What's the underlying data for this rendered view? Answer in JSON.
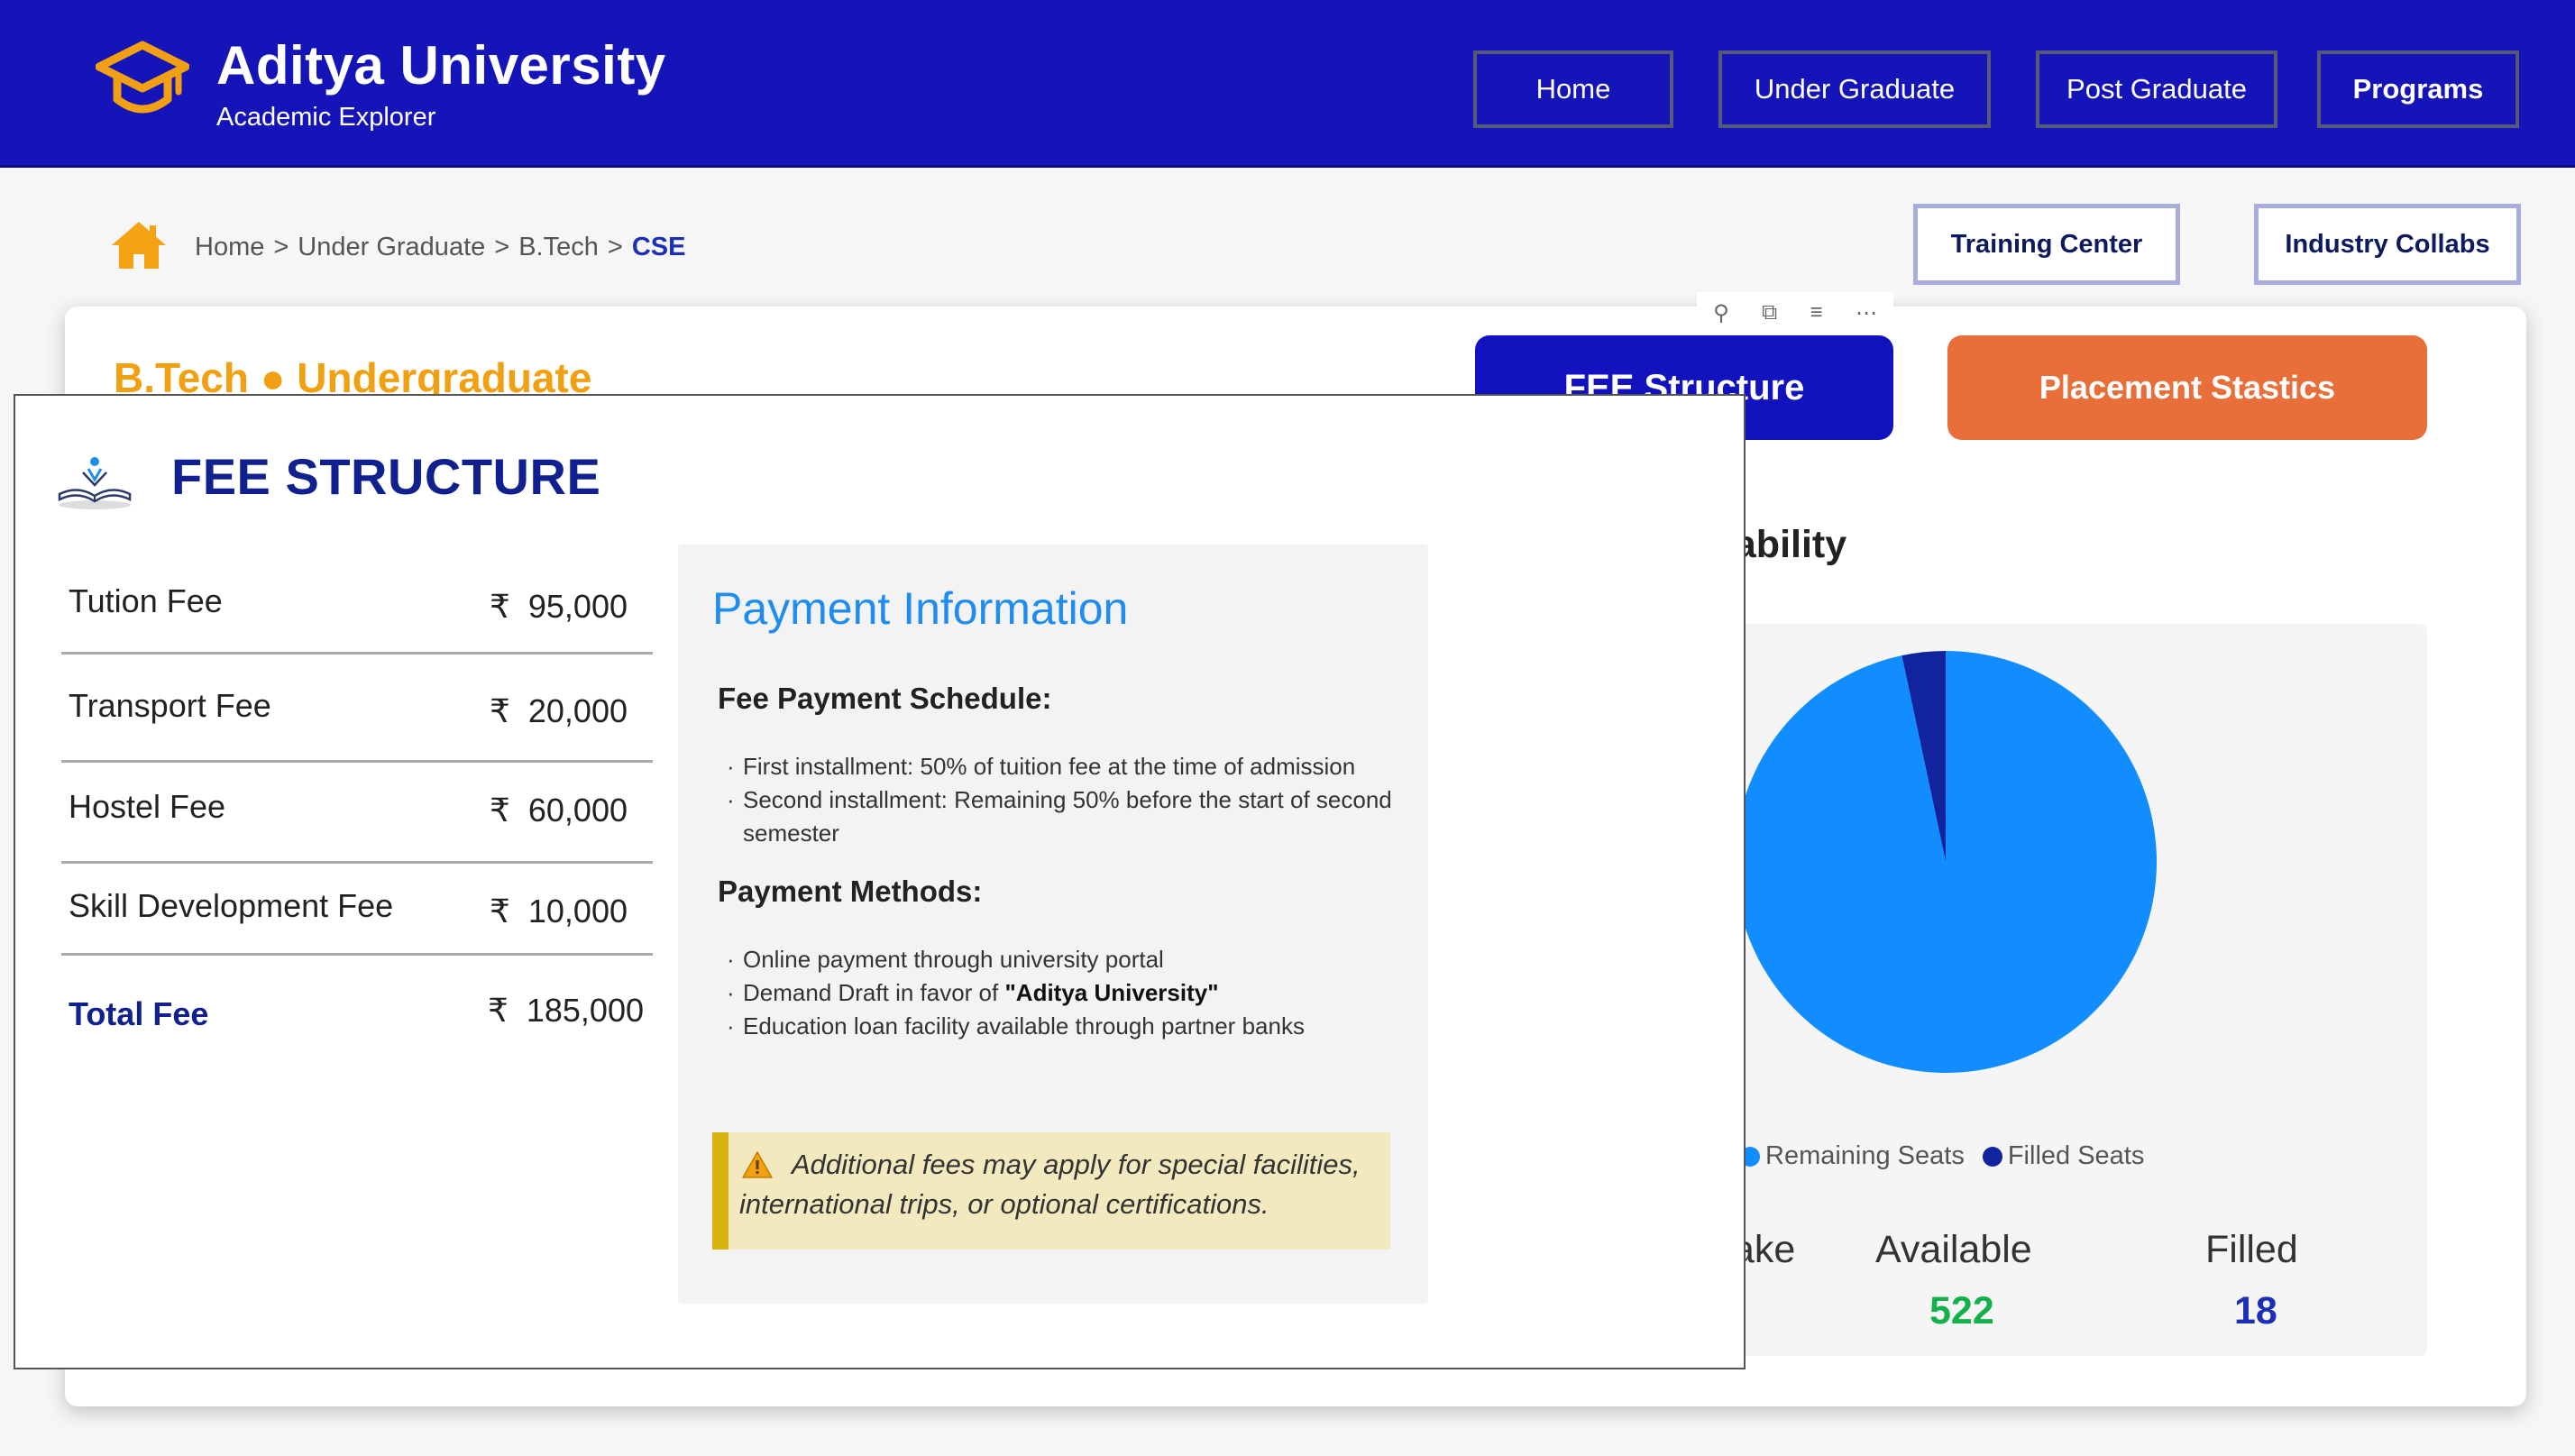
{
  "header": {
    "brand_title": "Aditya University",
    "brand_subtitle": "Academic Explorer",
    "nav": [
      {
        "label": "Home"
      },
      {
        "label": "Under Graduate"
      },
      {
        "label": "Post Graduate"
      },
      {
        "label": "Programs"
      }
    ],
    "colors": {
      "background": "#1414b8",
      "logo": "#f0a011"
    }
  },
  "breadcrumb": {
    "items": [
      "Home",
      "Under Graduate",
      "B.Tech"
    ],
    "separator": ">",
    "current": "CSE"
  },
  "actions": {
    "training_center": "Training Center",
    "industry_collabs": "Industry Collabs"
  },
  "card": {
    "title": "B.Tech ● Undergraduate",
    "fee_button": "FEE Structure",
    "placement_button": "Placement Stastics",
    "chart_heading_fragment": "ilability",
    "visual_toolbar": [
      "pin-icon",
      "copy-icon",
      "filter-icon",
      "more-icon"
    ]
  },
  "chart_data": {
    "type": "pie",
    "series": [
      {
        "name": "Remaining Seats",
        "value": 522,
        "color": "#118dff"
      },
      {
        "name": "Filled Seats",
        "value": 18,
        "color": "#12239e"
      }
    ],
    "legend_position": "bottom-left"
  },
  "stats": {
    "intake_fragment": "ake",
    "available_label": "Available",
    "available_value": "522",
    "filled_label": "Filled",
    "filled_value": "18",
    "colors": {
      "available": "#14b04c",
      "filled": "#1c2fb5"
    }
  },
  "fee_popup": {
    "title": "FEE STRUCTURE",
    "currency": "₹",
    "rows": [
      {
        "name": "Tution Fee",
        "amount": "95,000"
      },
      {
        "name": "Transport Fee",
        "amount": "20,000"
      },
      {
        "name": "Hostel Fee",
        "amount": "60,000"
      },
      {
        "name": "Skill Development Fee",
        "amount": "10,000"
      }
    ],
    "total": {
      "name": "Total Fee",
      "amount": "185,000"
    },
    "payment": {
      "title": "Payment Information",
      "schedule_heading": "Fee Payment Schedule:",
      "schedule": [
        "First installment: 50% of tuition fee at the time of admission",
        "Second installment: Remaining 50% before the start of second semester"
      ],
      "methods_heading": "Payment Methods:",
      "method_online": "Online payment through university portal",
      "method_dd_prefix": "Demand Draft in favor of ",
      "method_dd_name": "\"Aditya University\"",
      "method_loan": "Education loan facility available through partner banks",
      "note": "Additional fees may apply for special facilities, international trips, or optional certifications."
    }
  }
}
